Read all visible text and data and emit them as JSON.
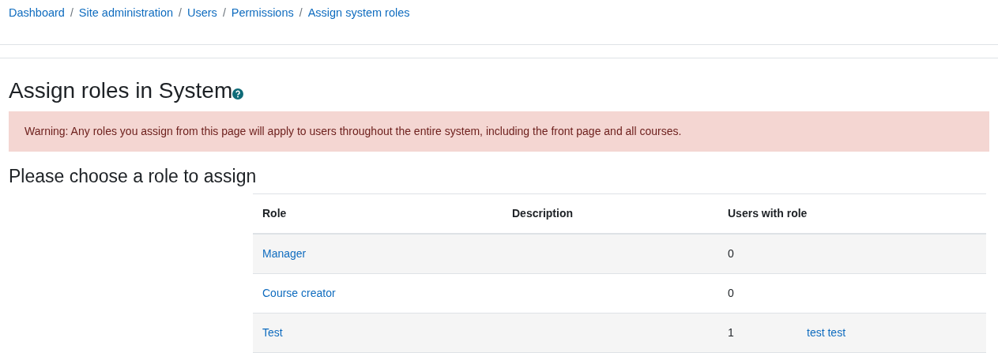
{
  "breadcrumb": [
    "Dashboard",
    "Site administration",
    "Users",
    "Permissions",
    "Assign system roles"
  ],
  "breadcrumb_separator": "/",
  "heading": "Assign roles in System",
  "warning": "Warning: Any roles you assign from this page will apply to users throughout the entire system, including the front page and all courses.",
  "subheading": "Please choose a role to assign",
  "table": {
    "columns": [
      "Role",
      "Description",
      "Users with role"
    ],
    "rows": [
      {
        "role": "Manager",
        "count": "0",
        "users": []
      },
      {
        "role": "Course creator",
        "count": "0",
        "users": []
      },
      {
        "role": "Test",
        "count": "1",
        "users": [
          "test test"
        ]
      }
    ]
  }
}
